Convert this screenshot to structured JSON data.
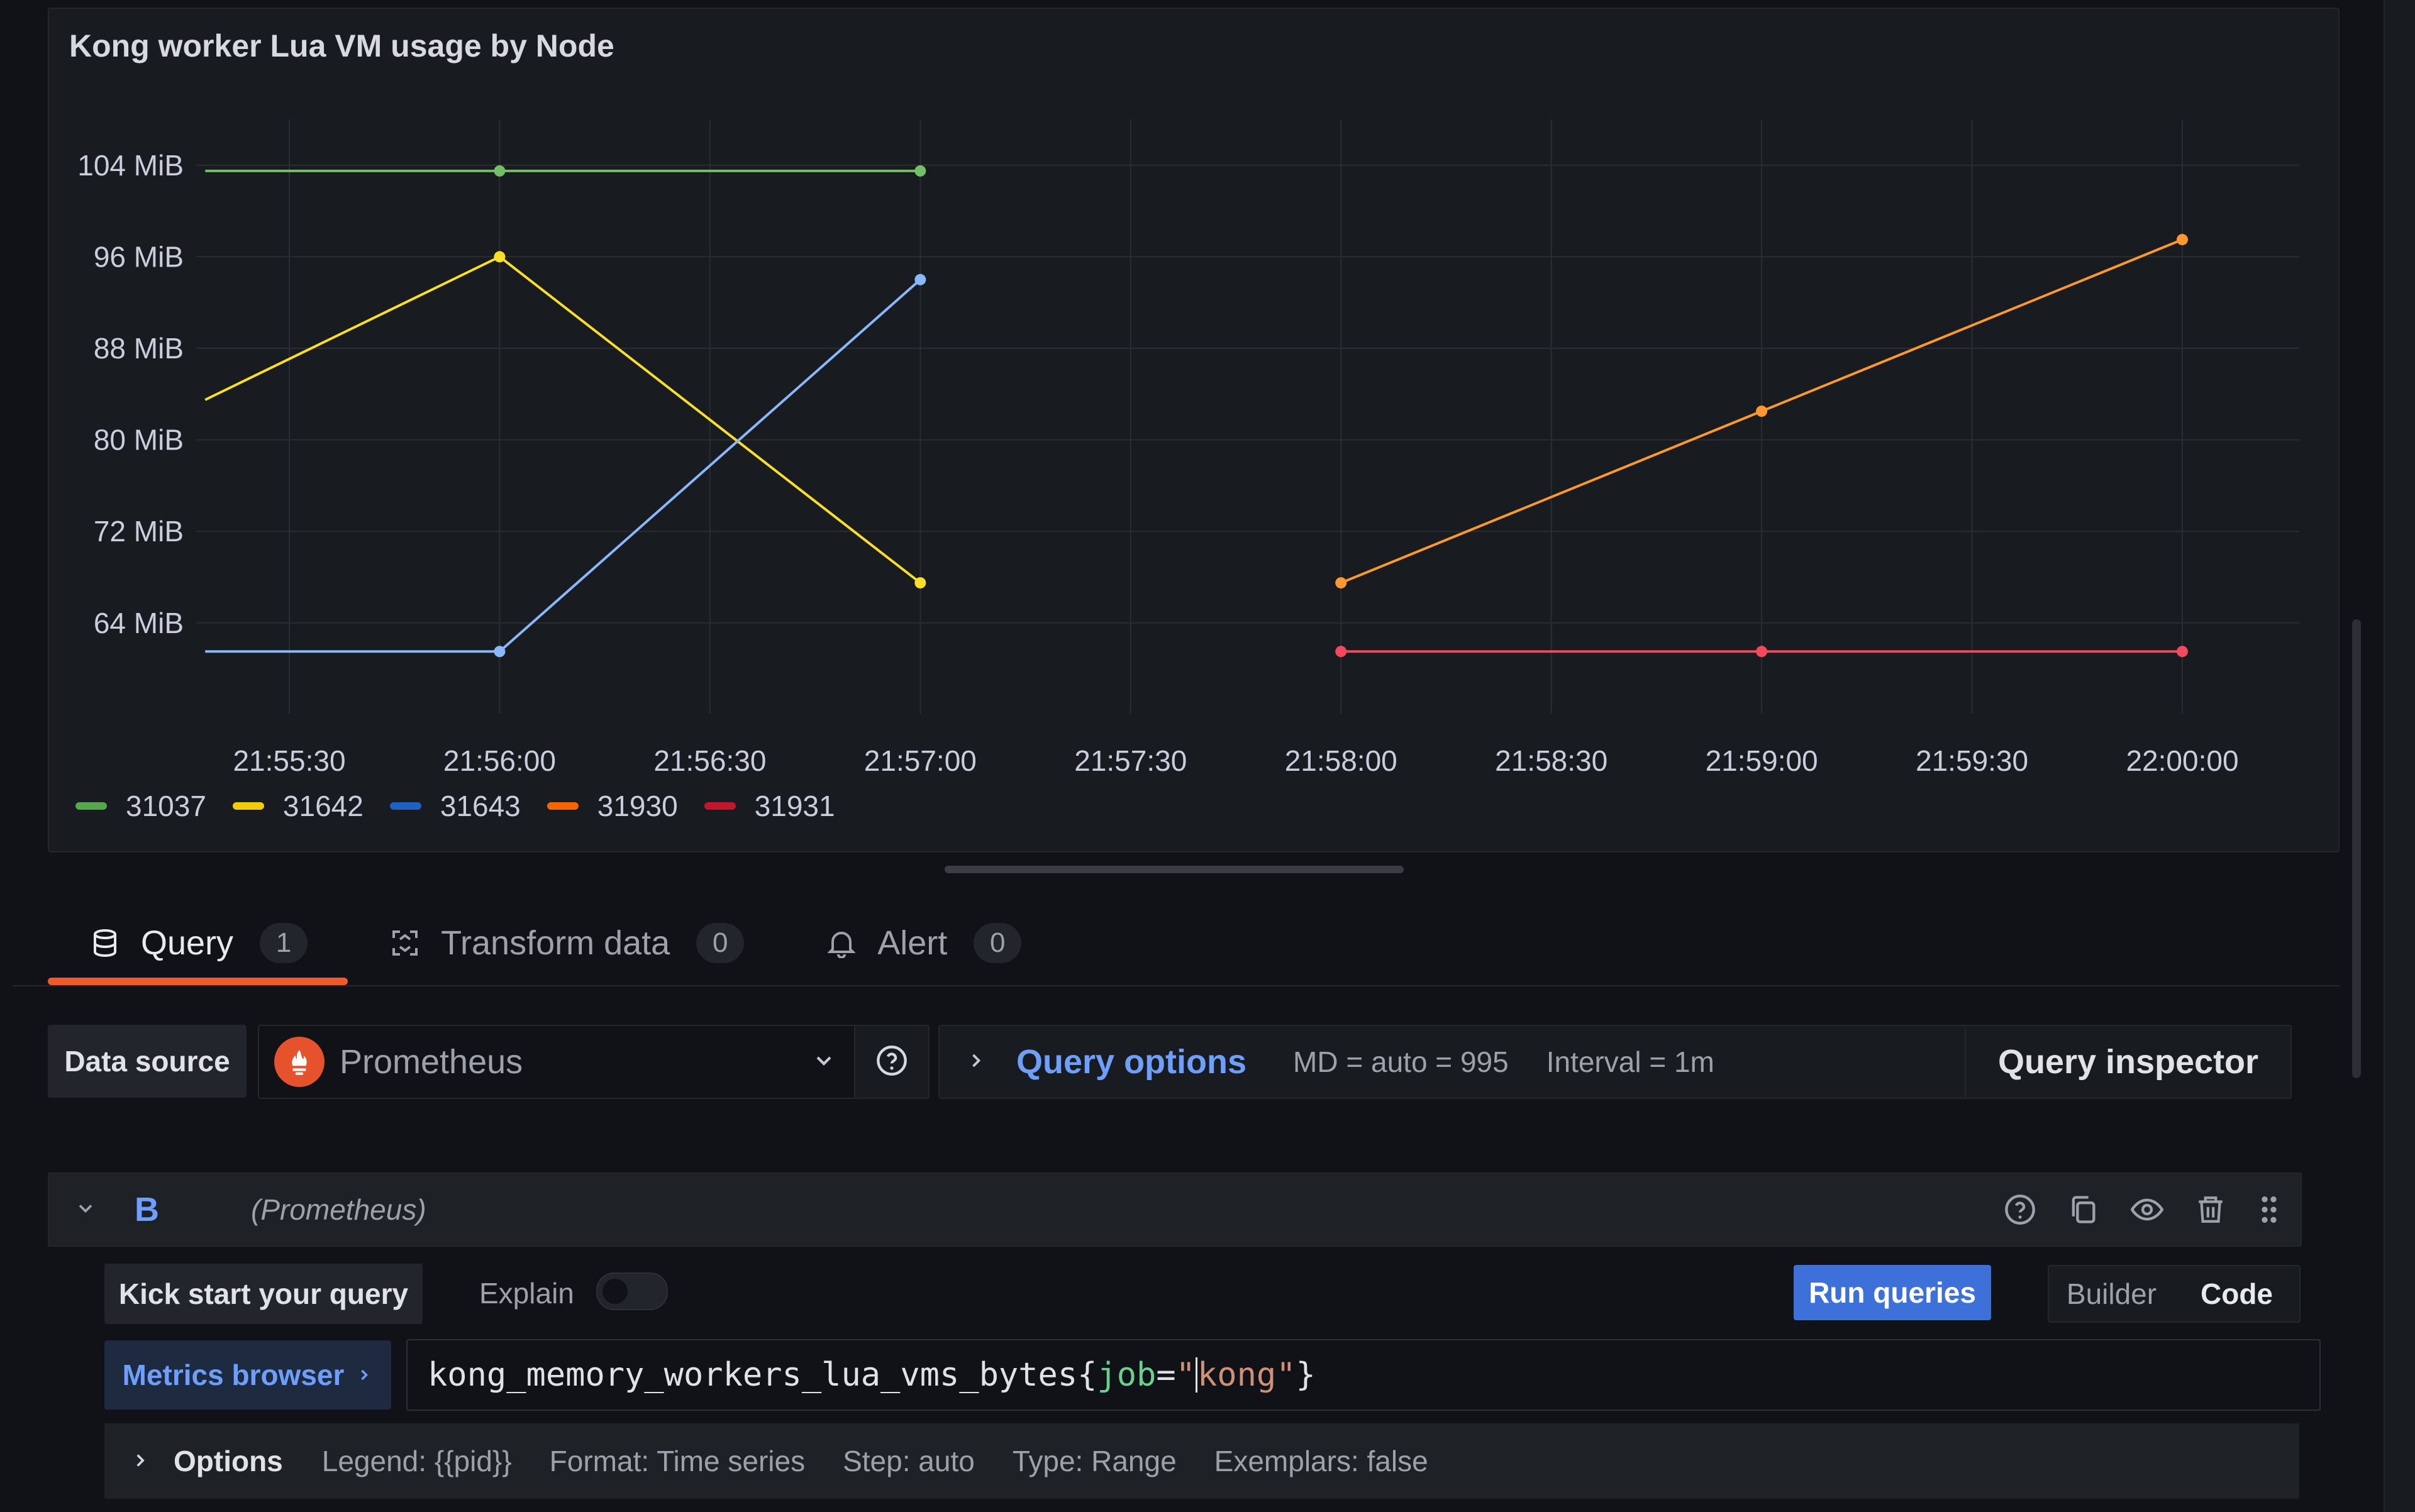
{
  "panel": {
    "title": "Kong worker Lua VM usage by Node"
  },
  "chart_data": {
    "type": "line",
    "title": "Kong worker Lua VM usage by Node",
    "y_ticks": [
      "104 MiB",
      "96 MiB",
      "88 MiB",
      "80 MiB",
      "72 MiB",
      "64 MiB"
    ],
    "x_ticks": [
      "21:55:30",
      "21:56:00",
      "21:56:30",
      "21:57:00",
      "21:57:30",
      "21:58:00",
      "21:58:30",
      "21:59:00",
      "21:59:30",
      "22:00:00"
    ],
    "ylim_mib": [
      58,
      108
    ],
    "grid": true,
    "legend_position": "bottom-left",
    "series": [
      {
        "name": "31037",
        "color": "#73bf69",
        "points": [
          [
            "21:55:18",
            103.5
          ],
          [
            "21:56:00",
            103.5
          ],
          [
            "21:57:00",
            103.5
          ]
        ]
      },
      {
        "name": "31642",
        "color": "#fade2a",
        "points": [
          [
            "21:55:18",
            83.5
          ],
          [
            "21:56:00",
            96
          ],
          [
            "21:57:00",
            67.5
          ]
        ]
      },
      {
        "name": "31643",
        "color": "#8ab8ff",
        "points": [
          [
            "21:55:18",
            61.5
          ],
          [
            "21:56:00",
            61.5
          ],
          [
            "21:57:00",
            94
          ]
        ]
      },
      {
        "name": "31930",
        "color": "#ff9830",
        "points": [
          [
            "21:58:00",
            67.5
          ],
          [
            "21:59:00",
            82.5
          ],
          [
            "22:00:00",
            97.5
          ]
        ]
      },
      {
        "name": "31931",
        "color": "#f2495c",
        "points": [
          [
            "21:58:00",
            61.5
          ],
          [
            "21:59:00",
            61.5
          ],
          [
            "22:00:00",
            61.5
          ]
        ]
      }
    ]
  },
  "legend": [
    {
      "label": "31037",
      "color": "#56a64b"
    },
    {
      "label": "31642",
      "color": "#f2cc0c"
    },
    {
      "label": "31643",
      "color": "#1f60c4"
    },
    {
      "label": "31930",
      "color": "#fa6400"
    },
    {
      "label": "31931",
      "color": "#c4162a"
    }
  ],
  "tabs": [
    {
      "label": "Query",
      "count": "1",
      "icon": "database-icon"
    },
    {
      "label": "Transform data",
      "count": "0",
      "icon": "transform-icon"
    },
    {
      "label": "Alert",
      "count": "0",
      "icon": "bell-icon"
    }
  ],
  "toolbar": {
    "datasource_label": "Data source",
    "datasource_value": "Prometheus",
    "query_options_title": "Query options",
    "md": "MD = auto = 995",
    "interval": "Interval = 1m",
    "query_inspector": "Query inspector"
  },
  "query": {
    "ref_id": "B",
    "datasource": "(Prometheus)",
    "kick_start": "Kick start your query",
    "explain": "Explain",
    "run": "Run queries",
    "builder": "Builder",
    "code": "Code",
    "metrics_browser": "Metrics browser",
    "expr_metric": "kong_memory_workers_lua_vms_bytes{",
    "expr_label": "job",
    "expr_eq": "=",
    "expr_q1": "\"",
    "expr_value": "kong\"",
    "expr_close": "}",
    "options_title": "Options",
    "opt_legend": "Legend: {{pid}}",
    "opt_format": "Format: Time series",
    "opt_step": "Step: auto",
    "opt_type": "Type: Range",
    "opt_exemplars": "Exemplars: false"
  }
}
